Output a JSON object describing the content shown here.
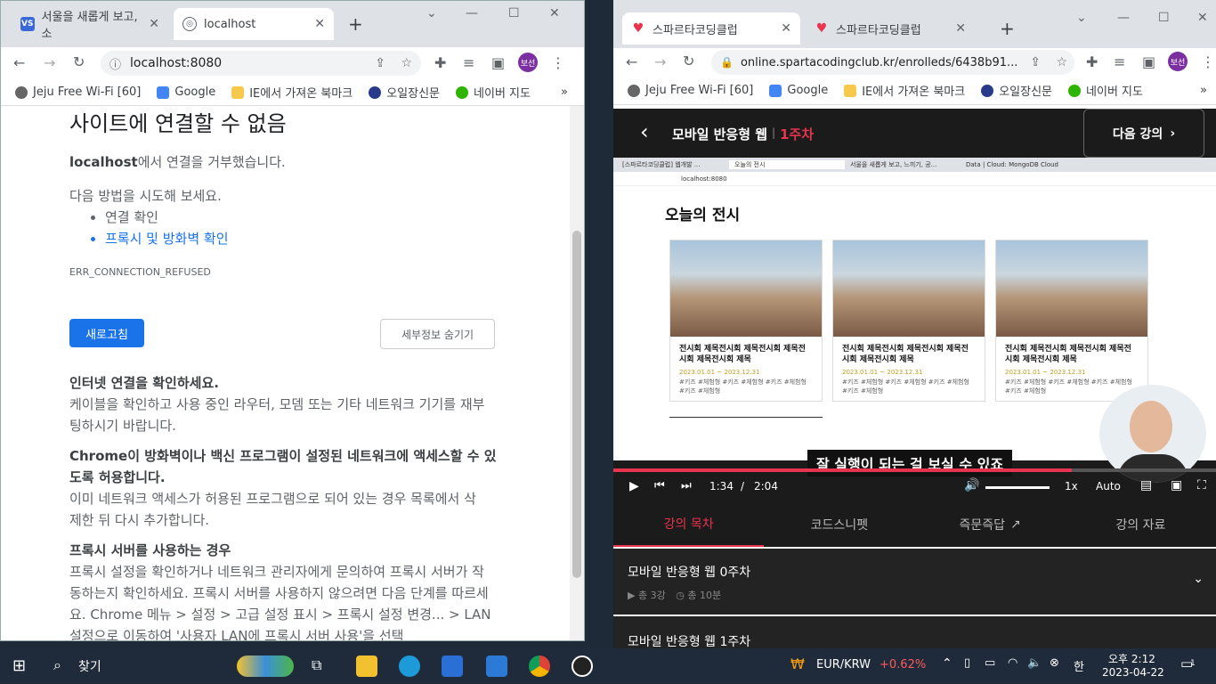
{
  "left_window": {
    "tabs": [
      {
        "label": "서울을 새롭게 보고, 소",
        "active": false
      },
      {
        "label": "localhost",
        "active": true
      }
    ],
    "url": "localhost:8080",
    "profile": "보선",
    "bookmarks": [
      "Jeju Free Wi-Fi [60]",
      "Google",
      "IE에서 가져온 북마크",
      "오일장신문",
      "네이버 지도"
    ],
    "error": {
      "title": "사이트에 연결할 수 없음",
      "host": "localhost",
      "refused": "에서 연결을 거부했습니다.",
      "try_heading": "다음 방법을 시도해 보세요.",
      "try_items": [
        "연결 확인",
        "프록시 및 방화벽 확인"
      ],
      "code": "ERR_CONNECTION_REFUSED",
      "reload": "새로고침",
      "details": "세부정보 숨기기",
      "sec1_title": "인터넷 연결을 확인하세요.",
      "sec1_body": "케이블을 확인하고 사용 중인 라우터, 모뎀 또는 기타 네트워크 기기를 재부팅하시기 바랍니다.",
      "sec2_title": "Chrome이 방화벽이나 백신 프로그램이 설정된 네트워크에 액세스할 수 있도록 허용합니다.",
      "sec2_body": "이미 네트워크 액세스가 허용된 프로그램으로 되어 있는 경우 목록에서 삭제한 뒤 다시 추가합니다.",
      "sec3_title": "프록시 서버를 사용하는 경우",
      "sec3_body": "프록시 설정을 확인하거나 네트워크 관리자에게 문의하여 프록시 서버가 작동하는지 확인하세요. 프록시 서버를 사용하지 않으려면 다음 단계를 따르세요. Chrome 메뉴 > 설정 > 고급 설정 표시 > 프록시 설정 변경... > LAN 설정으로 이동하여 '사용자 LAN에 프록시 서버 사용'을 선택"
    }
  },
  "right_window": {
    "tabs": [
      {
        "label": "스파르타코딩클럽",
        "active": true
      },
      {
        "label": "스파르타코딩클럽",
        "active": false
      }
    ],
    "url": "online.spartacodingclub.kr/enrolleds/6438b91...",
    "profile": "보선",
    "bookmarks": [
      "Jeju Free Wi-Fi [60]",
      "Google",
      "IE에서 가져온 북마크",
      "오일장신문",
      "네이버 지도"
    ],
    "course_title": "모바일 반응형 웹",
    "week": "1주차",
    "next_lecture": "다음 강의",
    "video": {
      "inner_tabs": [
        "[스파르타코딩클럽] 웹개발 ...",
        "오늘의 전시",
        "서울을 새롭게 보고, 느끼기, 공...",
        "Data | Cloud: MongoDB Cloud"
      ],
      "inner_url": "localhost:8080",
      "page_title": "오늘의 전시",
      "card_title": "전시회 제목전시회 제목전시회 제목전시회 제목전시회 제목",
      "card_date": "2023.01.01 ~ 2023.12.31",
      "card_tags": "#키즈 #체험형 #키즈 #체험형 #키즈 #체험형 #키즈 #체험형",
      "subtitle": "잘 실행이 되는 걸 보실 수 있죠",
      "current_time": "1:34",
      "separator": "/",
      "duration": "2:04",
      "speed": "1x",
      "quality": "Auto",
      "progress": 0.76
    },
    "bottom_tabs": [
      "강의 목차",
      "코드스니펫",
      "즉문즉답",
      "강의 자료"
    ],
    "lessons": [
      {
        "title": "모바일 반응형 웹 0주차",
        "meta1": "총 3강",
        "meta2": "총 10분"
      },
      {
        "title": "모바일 반응형 웹 1주차"
      }
    ]
  },
  "taskbar": {
    "search": "찾기",
    "currency": "EUR/KRW",
    "change": "+0.62%",
    "ime": "한",
    "time": "오후 2:12",
    "date": "2023-04-22",
    "notifications": "1"
  }
}
